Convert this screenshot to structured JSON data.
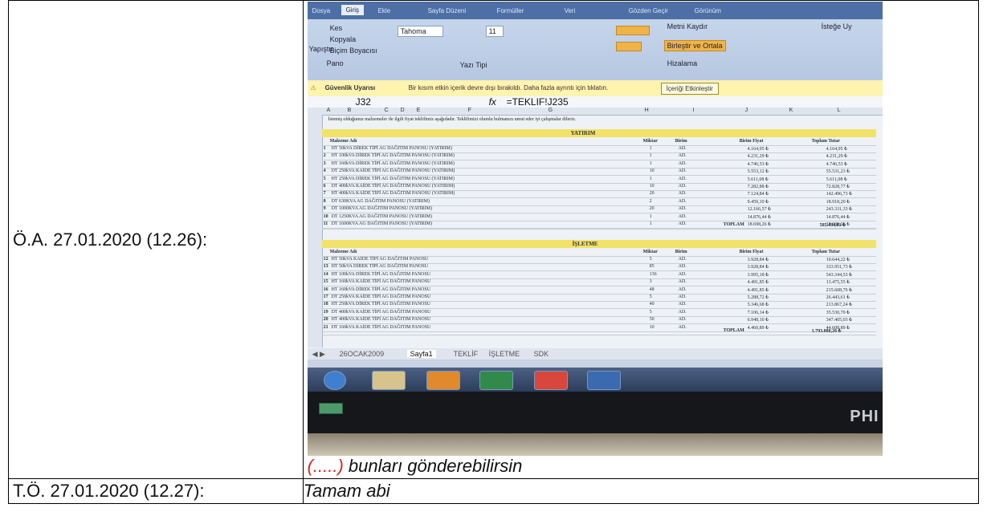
{
  "rows": [
    {
      "label": "Ö.A. 27.01.2020 (12.26):",
      "caption_dots": "(.....)",
      "caption_text": " bunları gönderebilirsin"
    },
    {
      "label": "T.Ö. 27.01.2020 (12.27):",
      "text": "Tamam abi"
    }
  ],
  "photo": {
    "formula_cell": "J32",
    "formula": "=TEKLIF!J235",
    "security_label": "Güvenlik Uyarısı",
    "security_text": "Bir kısım etkin içerik devre dışı bırakıldı. Daha fazla ayrıntı için tıklatın.",
    "security_button": "İçeriği Etkinleştir",
    "ribbon_tabs": [
      "Dosya",
      "Giriş",
      "Ekle",
      "Sayfa Düzeni",
      "Formüller",
      "Veri",
      "Gözden Geçir",
      "Görünüm"
    ],
    "ribbon": {
      "cut": "Kes",
      "copy": "Kopyala",
      "paste": "Yapıştır",
      "format_painter": "Biçim Boyacısı",
      "clipboard": "Pano",
      "font": "Tahoma",
      "font_size": "11",
      "font_group": "Yazı Tipi",
      "wrap": "Metni Kaydır",
      "merge": "Birleştir ve Ortala",
      "alignment": "Hizalama",
      "number_format": "İsteğe Uy"
    },
    "intro_text": "İstemiş olduğunuz malzemeler ile ilgili fiyat teklifimiz aşağıdadır. Teklifimizi olumlu bulmanızı umut eder iyi çalışmalar dileriz.",
    "yatirim_title": "YATIRIM",
    "isletme_title": "İŞLETME",
    "headers": [
      "Malzeme Adı",
      "Miktar",
      "Birim",
      "Birim Fiyat",
      "Toplam Tutar"
    ],
    "yatirim_rows": [
      [
        "1",
        "HT 50kVA DİREK TİPİ AG DAĞITIM PANOSU (YATIRIM)",
        "1",
        "AD.",
        "4.164,95 ₺",
        "4.164,95 ₺"
      ],
      [
        "2",
        "HT 100kVA DİREK TİPİ AG DAĞITIM PANOSU (YATIRIM)",
        "1",
        "AD.",
        "4.231,29 ₺",
        "4.231,29 ₺"
      ],
      [
        "3",
        "HT 160kVA DİREK TİPİ AG DAĞITIM PANOSU (YATIRIM)",
        "1",
        "AD.",
        "4.746,53 ₺",
        "4.746,53 ₺"
      ],
      [
        "4",
        "DT 250kVA KAİDE TİPİ AG DAĞITIM PANOSU (YATIRIM)",
        "10",
        "AD.",
        "5.553,12 ₺",
        "55.531,23 ₺"
      ],
      [
        "5",
        "HT 250kVA DİREK TİPİ AG DAĞITIM PANOSU (YATIRIM)",
        "1",
        "AD.",
        "5.611,08 ₺",
        "5.611,08 ₺"
      ],
      [
        "6",
        "DT 400kVA KAİDE TİPİ AG DAĞITIM PANOSU (YATIRIM)",
        "10",
        "AD.",
        "7.282,88 ₺",
        "72.828,77 ₺"
      ],
      [
        "7",
        "HT 400kVA KAİDE TİPİ AG DAĞITIM PANOSU (YATIRIM)",
        "20",
        "AD.",
        "7.124,84 ₺",
        "142.496,73 ₺"
      ],
      [
        "8",
        "DT 630KVA AG DAĞITIM PANOSU (YATIRIM)",
        "2",
        "AD.",
        "9.459,10 ₺",
        "18.918,20 ₺"
      ],
      [
        "9",
        "DT 1000KVA AG DAĞITIM PANOSU (YATIRIM)",
        "20",
        "AD.",
        "12.166,57 ₺",
        "243.331,33 ₺"
      ],
      [
        "10",
        "DT 1250KVA AG DAĞITIM PANOSU (YATIRIM)",
        "1",
        "AD.",
        "14.876,44 ₺",
        "14.876,44 ₺"
      ],
      [
        "11",
        "DT 1600KVA AG DAĞITIM PANOSU (YATIRIM)",
        "1",
        "AD.",
        "18.698,26 ₺",
        "18.698,26 ₺"
      ]
    ],
    "yatirim_total_label": "TOPLAM",
    "yatirim_total": "585.434,81 ₺",
    "isletme_rows": [
      [
        "12",
        "HT 50kVA KAİDE TİPİ AG DAĞITIM PANOSU",
        "5",
        "AD.",
        "3.928,84 ₺",
        "19.644,22 ₺"
      ],
      [
        "13",
        "HT 50kVA DİREK TİPİ AG DAĞITIM PANOSU",
        "85",
        "AD.",
        "3.928,84 ₺",
        "333.951,73 ₺"
      ],
      [
        "14",
        "HT 100kVA DİREK TİPİ AG DAĞITIM PANOSU",
        "136",
        "AD.",
        "3.995,18 ₺",
        "543.344,53 ₺"
      ],
      [
        "15",
        "HT 160kVA KAİDE TİPİ AG DAĞITIM PANOSU",
        "3",
        "AD.",
        "4.491,85 ₺",
        "13.475,55 ₺"
      ],
      [
        "16",
        "HT 160kVA DİREK TİPİ AG DAĞITIM PANOSU",
        "48",
        "AD.",
        "4.491,85 ₺",
        "215.608,76 ₺"
      ],
      [
        "17",
        "DT 250kVA KAİDE TİPİ AG DAĞITIM PANOSU",
        "5",
        "AD.",
        "5.288,72 ₺",
        "26.443,61 ₺"
      ],
      [
        "18",
        "HT 250kVA DİREK TİPİ AG DAĞITIM PANOSU",
        "40",
        "AD.",
        "5.346,68 ₺",
        "213.867,24 ₺"
      ],
      [
        "19",
        "DT 400kVA KAİDE TİPİ AG DAĞITIM PANOSU",
        "5",
        "AD.",
        "7.106,14 ₺",
        "35.530,70 ₺"
      ],
      [
        "20",
        "HT 400kVA KAİDE TİPİ AG DAĞITIM PANOSU",
        "50",
        "AD.",
        "6.948,10 ₺",
        "347.405,03 ₺"
      ],
      [
        "21",
        "DT 160kVA KAİDE TİPİ AG DAĞITIM PANOSU",
        "10",
        "AD.",
        "4.460,89 ₺",
        "44.608,89 ₺"
      ]
    ],
    "isletme_total_label": "TOPLAM",
    "isletme_total": "1.793.880,26 ₺",
    "sheet_tabs": [
      "26OCAK2009",
      "Sayfa1",
      "TEKLİF",
      "İŞLETME",
      "SDK"
    ],
    "monitor_brand": "PHI"
  }
}
